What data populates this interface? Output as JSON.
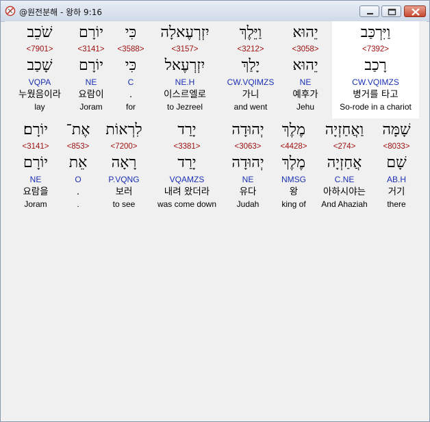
{
  "window": {
    "title": "@원전분해 - 왕하 9:16"
  },
  "colors": {
    "strong_number": "#a01010",
    "morphology": "#1a2fb5",
    "highlight_background": "#ffffff"
  },
  "icons": {
    "app": "book-compass-icon",
    "minimize": "minimize-icon",
    "maximize": "maximize-icon",
    "close": "close-icon"
  },
  "rows": [
    {
      "words": [
        {
          "hebrew": "וַיִּרְכַּב",
          "strong": "<7392>",
          "lemma": "רָכַב",
          "morph": "CW.VQIMZS",
          "korean": "병거를 타고",
          "english": "So-rode in a chariot",
          "highlighted": true
        },
        {
          "hebrew": "יֵהוּא",
          "strong": "<3058>",
          "lemma": "יֵהוּא",
          "morph": "NE",
          "korean": "예후가",
          "english": "Jehu",
          "highlighted": false
        },
        {
          "hebrew": "וַיֵּלֶךְ",
          "strong": "<3212>",
          "lemma": "יָלַךְ",
          "morph": "CW.VQIMZS",
          "korean": "가니",
          "english": "and went",
          "highlighted": false
        },
        {
          "hebrew": "יִזְרְעֶאלָה",
          "strong": "<3157>",
          "lemma": "יִזְרְעֶאל",
          "morph": "NE.H",
          "korean": "이스르엘로",
          "english": "to Jezreel",
          "highlighted": false
        },
        {
          "hebrew": "כִּי",
          "strong": "<3588>",
          "lemma": "כִּי",
          "morph": "C",
          "korean": ".",
          "english": "for",
          "highlighted": false
        },
        {
          "hebrew": "יוֹרָם",
          "strong": "<3141>",
          "lemma": "יוֹרָם",
          "morph": "NE",
          "korean": "요람이",
          "english": "Joram",
          "highlighted": false
        },
        {
          "hebrew": "שֹׁכֵב",
          "strong": "<7901>",
          "lemma": "שָׁכַב",
          "morph": "VQPA",
          "korean": "누웠음이라",
          "english": "lay",
          "highlighted": false
        }
      ]
    },
    {
      "words": [
        {
          "hebrew": "שָׁמָּה",
          "strong": "<8033>",
          "lemma": "שָׁם",
          "morph": "AB.H",
          "korean": "거기",
          "english": "there",
          "highlighted": false
        },
        {
          "hebrew": "וַאֲחַזְיָה",
          "strong": "<274>",
          "lemma": "אֲחַזְיָה",
          "morph": "C.NE",
          "korean": "아하시야는",
          "english": "And Ahaziah",
          "highlighted": false
        },
        {
          "hebrew": "מֶלֶךְ",
          "strong": "<4428>",
          "lemma": "מֶלֶךְ",
          "morph": "NMSG",
          "korean": "왕",
          "english": "king of",
          "highlighted": false
        },
        {
          "hebrew": "יְהוּדָה",
          "strong": "<3063>",
          "lemma": "יְהוּדָה",
          "morph": "NE",
          "korean": "유다",
          "english": "Judah",
          "highlighted": false
        },
        {
          "hebrew": "יָרַד",
          "strong": "<3381>",
          "lemma": "יָרַד",
          "morph": "VQAMZS",
          "korean": "내려 왔더라",
          "english": "was come down",
          "highlighted": false
        },
        {
          "hebrew": "לִרְאוֹת",
          "strong": "<7200>",
          "lemma": "רָאָה",
          "morph": "P.VQNG",
          "korean": "보러",
          "english": "to see",
          "highlighted": false
        },
        {
          "hebrew": "אֶת־",
          "strong": "<853>",
          "lemma": "אֵת",
          "morph": "O",
          "korean": ".",
          "english": ".",
          "highlighted": false
        },
        {
          "hebrew": "יוֹרָם׃",
          "strong": "<3141>",
          "lemma": "יוֹרָם",
          "morph": "NE",
          "korean": "요람을",
          "english": "Joram",
          "highlighted": false
        }
      ]
    }
  ]
}
